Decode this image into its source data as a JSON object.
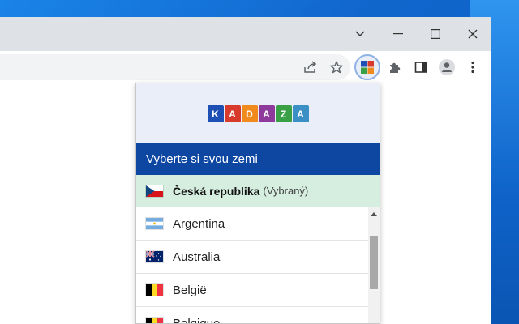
{
  "window": {
    "controls": {
      "tab_search_icon": "chevron-down-icon",
      "minimize_icon": "minimize-icon",
      "maximize_icon": "maximize-icon",
      "close_icon": "close-icon"
    }
  },
  "toolbar": {
    "icons": [
      "share-icon",
      "star-icon",
      "kadaza-extension-icon",
      "puzzle-icon",
      "side-panel-icon",
      "profile-icon",
      "menu-icon"
    ]
  },
  "popup": {
    "logo_letters": [
      "K",
      "A",
      "D",
      "A",
      "Z",
      "A"
    ],
    "logo_colors": [
      "#1e4fb4",
      "#d83a2b",
      "#f08a1c",
      "#8e3a9c",
      "#3aa046",
      "#3a8fc4"
    ],
    "title": "Vyberte si svou zemi",
    "selected": {
      "name": "Česká republika",
      "suffix": "(Vybraný)"
    },
    "countries": [
      {
        "name": "Argentina",
        "flag": "argentina-flag-icon"
      },
      {
        "name": "Australia",
        "flag": "australia-flag-icon"
      },
      {
        "name": "België",
        "flag": "belgium-flag-icon"
      },
      {
        "name": "Belgique",
        "flag": "belgium-flag-icon"
      }
    ],
    "scroll_position": 0.1
  },
  "colors": {
    "title_bar": "#0d47a1",
    "selected_row": "#d5eee0",
    "header": "#e9eef8"
  }
}
